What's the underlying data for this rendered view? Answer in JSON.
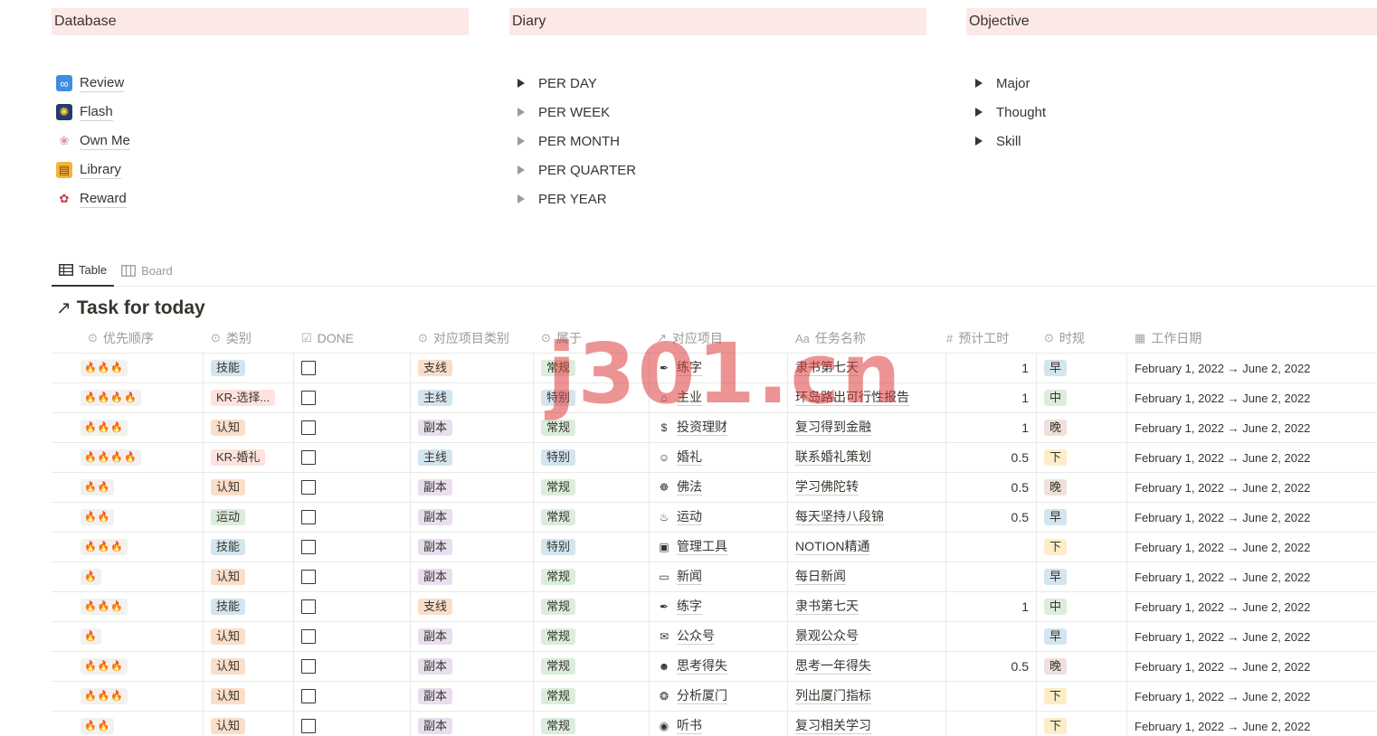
{
  "columns": {
    "database": {
      "title": "Database",
      "items": [
        {
          "label": "Review",
          "icon": "infinity-icon",
          "glyph": "∞",
          "bg": "#3d8ee0",
          "fg": "#ffffff"
        },
        {
          "label": "Flash",
          "icon": "fireworks-icon",
          "glyph": "✺",
          "bg": "#263a66",
          "fg": "#f6d24a"
        },
        {
          "label": "Own Me",
          "icon": "brain-icon",
          "glyph": "❀",
          "bg": "#ffffff",
          "fg": "#e08fa0"
        },
        {
          "label": "Library",
          "icon": "notebook-icon",
          "glyph": "▤",
          "bg": "#f3b43b",
          "fg": "#7a4a00"
        },
        {
          "label": "Reward",
          "icon": "candy-icon",
          "glyph": "✿",
          "bg": "#ffffff",
          "fg": "#c0394b"
        }
      ]
    },
    "diary": {
      "title": "Diary",
      "items": [
        "PER DAY",
        "PER WEEK",
        "PER MONTH",
        "PER QUARTER",
        "PER YEAR"
      ]
    },
    "objective": {
      "title": "Objective",
      "items": [
        "Major",
        "Thought",
        "Skill"
      ]
    }
  },
  "views": {
    "table": "Table",
    "board": "Board"
  },
  "db_title": "Task for today",
  "headers": {
    "priority": "优先顺序",
    "category": "类别",
    "done": "DONE",
    "proj_type": "对应项目类别",
    "belongs": "属于",
    "project": "对应项目",
    "task": "任务名称",
    "hours": "预计工时",
    "timing": "时规",
    "date": "工作日期"
  },
  "rows": [
    {
      "priority": "🔥🔥🔥",
      "category": "技能",
      "cat_color": "blue",
      "proj_type": "支线",
      "pt_color": "orange",
      "belongs": "常规",
      "b_color": "green",
      "proj_icon": "✒",
      "project": "练字",
      "task": "隶书第七天",
      "hours": "1",
      "timing": "早",
      "t_color": "blue",
      "date": "February 1, 2022 → June 2, 2022"
    },
    {
      "priority": "🔥🔥🔥🔥",
      "category": "KR-选择...",
      "cat_color": "red",
      "proj_type": "主线",
      "pt_color": "blue",
      "belongs": "特别",
      "b_color": "blue",
      "proj_icon": "⌂",
      "project": "主业",
      "task": "环岛路出可行性报告",
      "hours": "1",
      "timing": "中",
      "t_color": "green",
      "date": "February 1, 2022 → June 2, 2022"
    },
    {
      "priority": "🔥🔥🔥",
      "category": "认知",
      "cat_color": "orange",
      "proj_type": "副本",
      "pt_color": "purple",
      "belongs": "常规",
      "b_color": "green",
      "proj_icon": "$",
      "project": "投资理财",
      "task": "复习得到金融",
      "hours": "1",
      "timing": "晚",
      "t_color": "brown",
      "date": "February 1, 2022 → June 2, 2022"
    },
    {
      "priority": "🔥🔥🔥🔥",
      "category": "KR-婚礼",
      "cat_color": "red",
      "proj_type": "主线",
      "pt_color": "blue",
      "belongs": "特别",
      "b_color": "blue",
      "proj_icon": "☺",
      "project": "婚礼",
      "task": "联系婚礼策划",
      "hours": "0.5",
      "timing": "下",
      "t_color": "yellow",
      "date": "February 1, 2022 → June 2, 2022"
    },
    {
      "priority": "🔥🔥",
      "category": "认知",
      "cat_color": "orange",
      "proj_type": "副本",
      "pt_color": "purple",
      "belongs": "常规",
      "b_color": "green",
      "proj_icon": "☸",
      "project": "佛法",
      "task": "学习佛陀转",
      "hours": "0.5",
      "timing": "晚",
      "t_color": "brown",
      "date": "February 1, 2022 → June 2, 2022"
    },
    {
      "priority": "🔥🔥",
      "category": "运动",
      "cat_color": "green",
      "proj_type": "副本",
      "pt_color": "purple",
      "belongs": "常规",
      "b_color": "green",
      "proj_icon": "♨",
      "project": "运动",
      "task": "每天坚持八段锦",
      "hours": "0.5",
      "timing": "早",
      "t_color": "blue",
      "date": "February 1, 2022 → June 2, 2022"
    },
    {
      "priority": "🔥🔥🔥",
      "category": "技能",
      "cat_color": "blue",
      "proj_type": "副本",
      "pt_color": "purple",
      "belongs": "特别",
      "b_color": "blue",
      "proj_icon": "▣",
      "project": "管理工具",
      "task": "NOTION精通",
      "hours": "",
      "timing": "下",
      "t_color": "yellow",
      "date": "February 1, 2022 → June 2, 2022"
    },
    {
      "priority": "🔥",
      "category": "认知",
      "cat_color": "orange",
      "proj_type": "副本",
      "pt_color": "purple",
      "belongs": "常规",
      "b_color": "green",
      "proj_icon": "▭",
      "project": "新闻",
      "task": "每日新闻",
      "hours": "",
      "timing": "早",
      "t_color": "blue",
      "date": "February 1, 2022 → June 2, 2022"
    },
    {
      "priority": "🔥🔥🔥",
      "category": "技能",
      "cat_color": "blue",
      "proj_type": "支线",
      "pt_color": "orange",
      "belongs": "常规",
      "b_color": "green",
      "proj_icon": "✒",
      "project": "练字",
      "task": "隶书第七天",
      "hours": "1",
      "timing": "中",
      "t_color": "green",
      "date": "February 1, 2022 → June 2, 2022"
    },
    {
      "priority": "🔥",
      "category": "认知",
      "cat_color": "orange",
      "proj_type": "副本",
      "pt_color": "purple",
      "belongs": "常规",
      "b_color": "green",
      "proj_icon": "✉",
      "project": "公众号",
      "task": "景观公众号",
      "hours": "",
      "timing": "早",
      "t_color": "blue",
      "date": "February 1, 2022 → June 2, 2022"
    },
    {
      "priority": "🔥🔥🔥",
      "category": "认知",
      "cat_color": "orange",
      "proj_type": "副本",
      "pt_color": "purple",
      "belongs": "常规",
      "b_color": "green",
      "proj_icon": "☻",
      "project": "思考得失",
      "task": "思考一年得失",
      "hours": "0.5",
      "timing": "晚",
      "t_color": "brown",
      "date": "February 1, 2022 → June 2, 2022"
    },
    {
      "priority": "🔥🔥🔥",
      "category": "认知",
      "cat_color": "orange",
      "proj_type": "副本",
      "pt_color": "purple",
      "belongs": "常规",
      "b_color": "green",
      "proj_icon": "❂",
      "project": "分析厦门",
      "task": "列出厦门指标",
      "hours": "",
      "timing": "下",
      "t_color": "yellow",
      "date": "February 1, 2022 → June 2, 2022"
    },
    {
      "priority": "🔥🔥",
      "category": "认知",
      "cat_color": "orange",
      "proj_type": "副本",
      "pt_color": "purple",
      "belongs": "常规",
      "b_color": "green",
      "proj_icon": "◉",
      "project": "听书",
      "task": "复习相关学习",
      "hours": "",
      "timing": "下",
      "t_color": "yellow",
      "date": "February 1, 2022 → June 2, 2022"
    }
  ],
  "watermark": "j301.cn"
}
